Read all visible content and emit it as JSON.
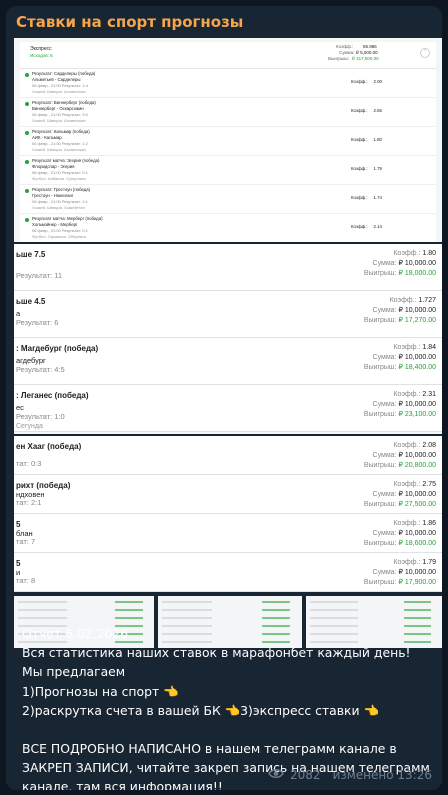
{
  "channel": {
    "name": "Ставки на спорт прогнозы"
  },
  "shot1": {
    "title": "Экспресс",
    "subtitle": "Исходов: 6",
    "k_label": "Коэфф.:",
    "k_value": "65.986",
    "sum_label": "Сумма:",
    "sum_value": "₽ 5,000.00",
    "win_label": "Выигрыш:",
    "win_value": "₽ 317,500.00",
    "legs": [
      {
        "l1": "Результат: Сарделеры (победа)",
        "l2": "Альметьев - Сарделеры",
        "l3": "06 февр., 21:00  Результат: 1:4",
        "l4": "Хоккей. Швеция. Алсвенскан",
        "k": "2.00"
      },
      {
        "l1": "Результат: Виннерберг (победа)",
        "l2": "Виннерберг - Оскарсхамн",
        "l3": "06 февр., 21:00  Результат: 3:0",
        "l4": "Хоккей. Швеция. Алсвенскан",
        "k": "2.65"
      },
      {
        "l1": "Результат: Кальмар (победа)",
        "l2": "АИК - Кальмар",
        "l3": "06 февр., 21:00  Результат: 1:2",
        "l4": "Хоккей. Швеция. Алсвенскан",
        "k": "1.80"
      },
      {
        "l1": "Результат матча: Эгерия (победа)",
        "l2": "Флоридспар - Эгерия",
        "l3": "06 февр., 21:00  Результат: 0:1",
        "l4": "Футбол. Албания. Суперлига",
        "k": "1.79"
      },
      {
        "l1": "Результат: Грестоун (победа)",
        "l2": "Грестоун - Нюнеланг",
        "l3": "06 февр., 21:00  Результат: 2:1",
        "l4": "Хоккей. Швеция. Хоккейттан",
        "k": "1.74"
      },
      {
        "l1": "Результат матча: Мерберг (победа)",
        "l2": "Хольмэйнер - Мерберг",
        "l3": "06 февр., 21:00  Результат: 0:1",
        "l4": "Футбол. Германия. Оберлига",
        "k": "2.14"
      }
    ]
  },
  "shot2": {
    "rows": [
      {
        "a": "ьше 7.5",
        "b": "",
        "c": "Результат: 11",
        "d": "",
        "k": "1.80",
        "s": "₽ 10,000.00",
        "w": "₽ 18,000.00"
      },
      {
        "a": "ьше 4.5",
        "b": "а",
        "c": "Результат: 6",
        "d": "",
        "k": "1.727",
        "s": "₽ 10,000.00",
        "w": "₽ 17,270.00"
      },
      {
        "a": ": Магдебург (победа)",
        "b": "агдебург",
        "c": "Результат: 4:5",
        "d": "",
        "k": "1.84",
        "s": "₽ 10,000.00",
        "w": "₽ 18,400.00"
      },
      {
        "a": ": Леганес (победа)",
        "b": "ес",
        "c": "Результат: 1:0",
        "d": "Сегунда",
        "k": "2.31",
        "s": "₽ 10,000.00",
        "w": "₽ 23,100.00"
      }
    ],
    "k_label": "Коэфф.:",
    "sum_label": "Сумма:",
    "win_label": "Выигрыш:"
  },
  "shot3": {
    "rows": [
      {
        "a": "ен Хааг (победа)",
        "b": "",
        "c": "тат: 0:3",
        "k": "2.08",
        "s": "₽ 10,000.00",
        "w": "₽ 20,800.00"
      },
      {
        "a": "рихт (победа)",
        "b": "ндховен",
        "c": "тат: 2:1",
        "k": "2.75",
        "s": "₽ 10,000.00",
        "w": "₽ 27,500.00"
      },
      {
        "a": "5",
        "b": "блан",
        "c": "тат: 7",
        "k": "1.86",
        "s": "₽ 10,000.00",
        "w": "₽ 18,600.00"
      },
      {
        "a": "5",
        "b": "и",
        "c": "тат: 8",
        "k": "1.79",
        "s": "₽ 10,000.00",
        "w": "₽ 17,900.00"
      }
    ],
    "k_label": "Коэфф.:",
    "sum_label": "Сумма:",
    "win_label": "Выигрыш:"
  },
  "message": {
    "lines": [
      "Отчет    6.02.2026",
      "Вся статистика наших ставок в марафонбет каждый день!",
      "Мы предлагаем",
      "1)Прогнозы на спорт 👈",
      "2)раскрутка счета в вашей БК 👈3)экспресс ставки 👈",
      "",
      "ВСЕ ПОДРОБНО НАПИСАНО в нашем телеграмм канале в",
      "ЗАКРЕП ЗАПИСИ, читайте закреп запись на нашем телеграмм",
      "канале, там вся информация!!"
    ]
  },
  "meta": {
    "views": "2082",
    "edited": "изменено 13:26",
    "eye_icon": "eye-icon"
  }
}
